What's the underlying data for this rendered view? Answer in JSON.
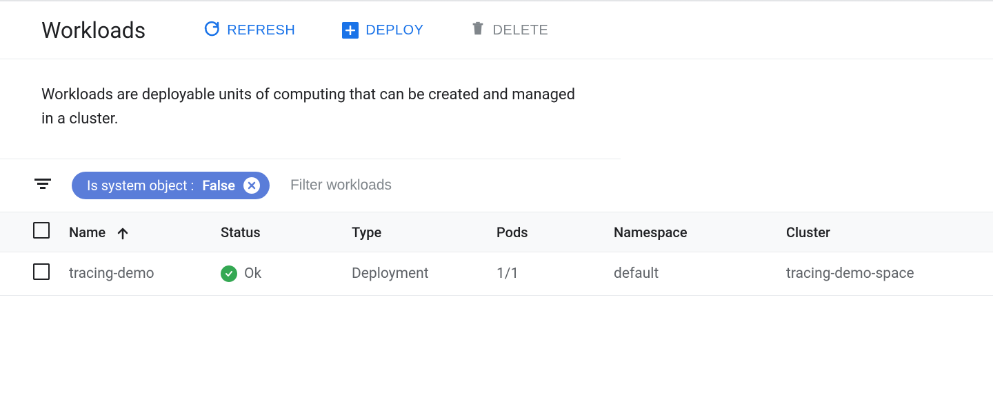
{
  "header": {
    "title": "Workloads",
    "actions": {
      "refresh": "REFRESH",
      "deploy": "DEPLOY",
      "delete": "DELETE"
    }
  },
  "description": "Workloads are deployable units of computing that can be created and managed in a cluster.",
  "filter": {
    "chip_key": "Is system object :",
    "chip_value": "False",
    "placeholder": "Filter workloads"
  },
  "table": {
    "columns": {
      "name": "Name",
      "status": "Status",
      "type": "Type",
      "pods": "Pods",
      "namespace": "Namespace",
      "cluster": "Cluster"
    },
    "rows": [
      {
        "name": "tracing-demo",
        "status": "Ok",
        "type": "Deployment",
        "pods": "1/1",
        "namespace": "default",
        "cluster": "tracing-demo-space"
      }
    ]
  }
}
